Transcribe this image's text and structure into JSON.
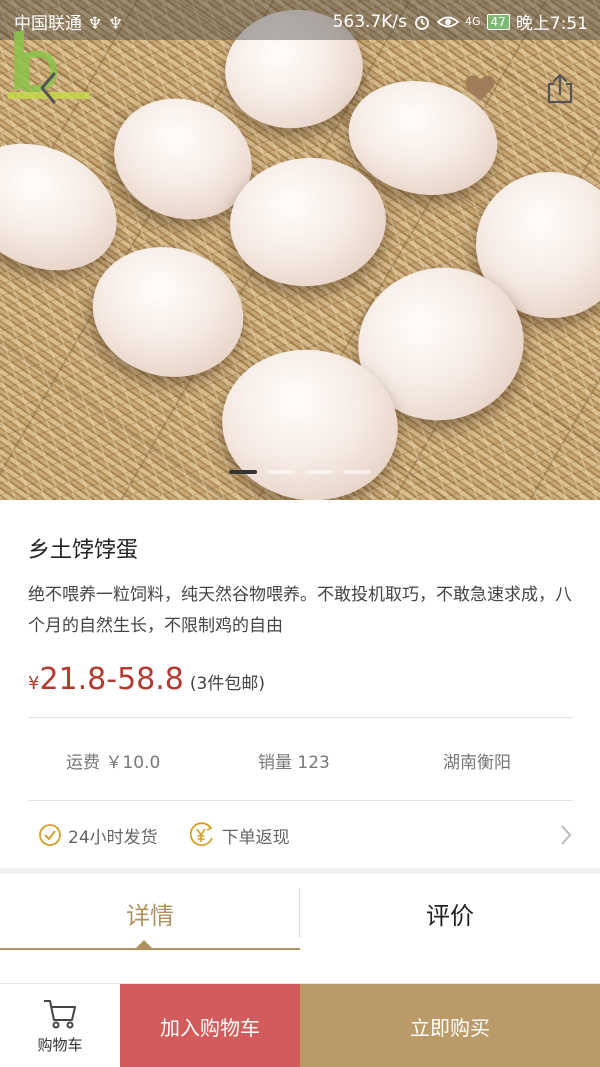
{
  "status_bar": {
    "carrier": "中国联通",
    "usb_icons": "♆ ♆",
    "speed": "563.7K/s",
    "network": "4G",
    "battery": "47",
    "time": "晚上7:51"
  },
  "nav": {
    "back_icon": "chevron-left-icon",
    "favorite_icon": "heart-icon",
    "share_icon": "share-icon"
  },
  "carousel": {
    "slides": 4,
    "active_index": 0
  },
  "product": {
    "title": "乡土饽饽蛋",
    "description": "绝不喂养一粒饲料，纯天然谷物喂养。不敢投机取巧，不敢急速求成，八个月的自然生长，不限制鸡的自由",
    "price_symbol": "¥",
    "price": "21.8-58.8",
    "price_note": "(3件包邮)"
  },
  "meta": {
    "shipping": "运费 ￥10.0",
    "sales": "销量  123",
    "origin": "湖南衡阳"
  },
  "features": {
    "ship_fast": "24小时发货",
    "cashback": "下单返现"
  },
  "tabs": {
    "detail": "详情",
    "review": "评价"
  },
  "bottom": {
    "cart": "购物车",
    "add_to_cart": "加入购物车",
    "buy_now": "立即购买"
  },
  "colors": {
    "accent_gold": "#b0925f",
    "price_red": "#b33a2e",
    "add_button": "#d25c5c",
    "buy_button": "#b99a68"
  }
}
